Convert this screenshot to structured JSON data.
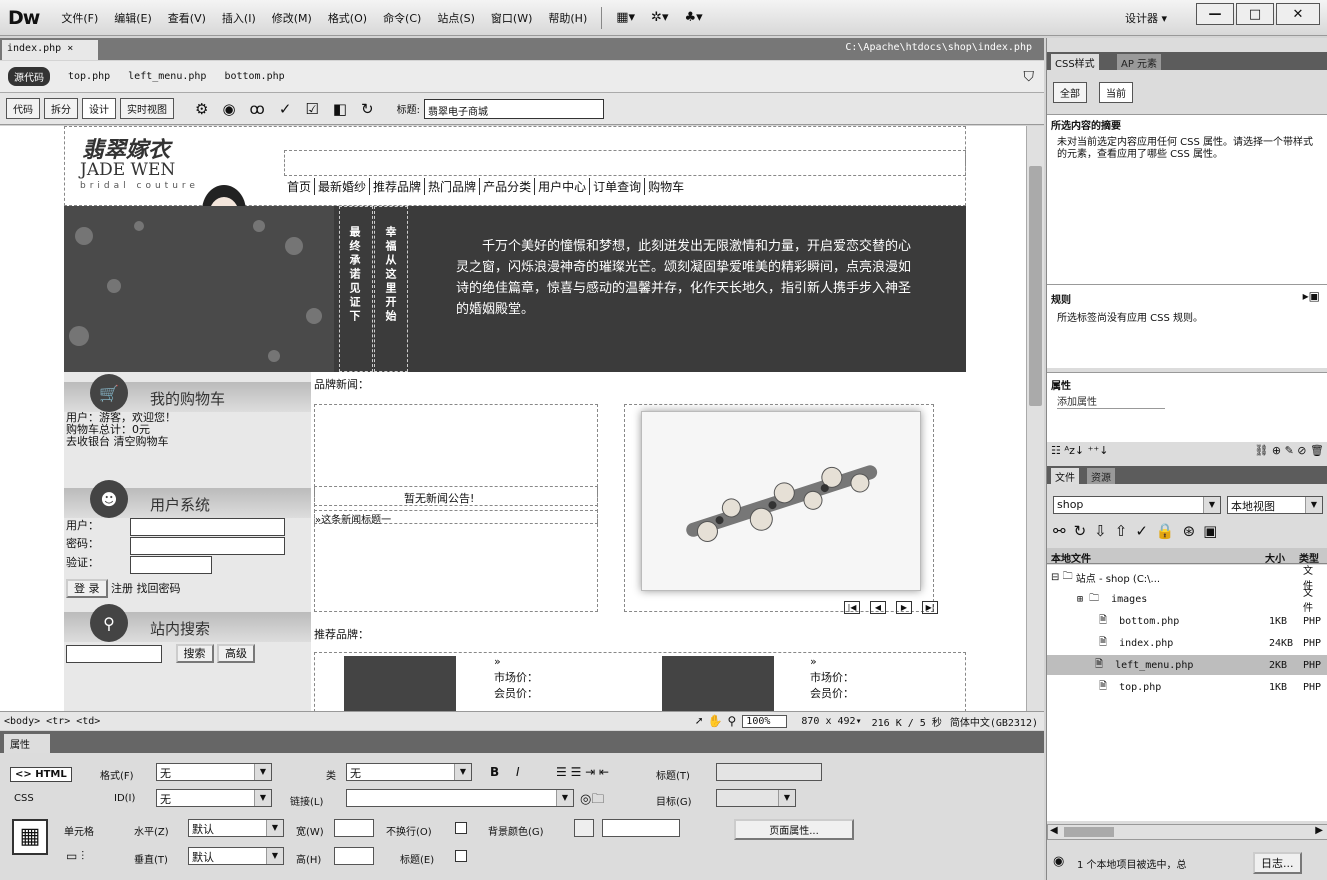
{
  "app": {
    "logo": "Dw",
    "designer": "设计器 ▾"
  },
  "menu": [
    "文件(F)",
    "编辑(E)",
    "查看(V)",
    "插入(I)",
    "修改(M)",
    "格式(O)",
    "命令(C)",
    "站点(S)",
    "窗口(W)",
    "帮助(H)"
  ],
  "doc": {
    "tab": "index.php ×",
    "path": "C:\\Apache\\htdocs\\shop\\index.php",
    "source_code": "源代码",
    "related": [
      "top.php",
      "left_menu.php",
      "bottom.php"
    ]
  },
  "toolbar": {
    "views": [
      "代码",
      "拆分",
      "设计",
      "实时视图"
    ],
    "title_label": "标题:",
    "title_value": "翡翠电子商城"
  },
  "site": {
    "logo_cn": "翡翠嫁衣",
    "logo_en": "JADE WEN",
    "logo_sub": "bridal couture",
    "nav": [
      "首页",
      "最新婚纱",
      "推荐品牌",
      "热门品牌",
      "产品分类",
      "用户中心",
      "订单查询",
      "购物车"
    ],
    "vtext1": "最终承诺见证下",
    "vtext2": "幸福从这里开始",
    "banner_text": "千万个美好的憧憬和梦想，此刻迸发出无限激情和力量，开启爱恋交替的心灵之窗，闪烁浪漫神奇的璀璨光芒。颂刻凝固挚爱唯美的精彩瞬间，点亮浪漫如诗的绝佳篇章，惊喜与感动的温馨并存，化作天长地久，指引新人携手步入神圣的婚姻殿堂。",
    "cart": {
      "title": "我的购物车",
      "line1": "用户：游客，欢迎您！",
      "line2": "购物车总计：0元",
      "line3": "去收银台  清空购物车"
    },
    "user": {
      "title": "用户系统",
      "user_label": "用户：",
      "pwd_label": "密码：",
      "code_label": "验证：",
      "login": "登 录",
      "links": "注册 找回密码"
    },
    "search": {
      "title": "站内搜索",
      "search_btn": "搜索",
      "adv_btn": "高级"
    },
    "news": {
      "title": "品牌新闻：",
      "empty": "暂无新闻公告!",
      "item": "»这条新闻标题一"
    },
    "brands": {
      "title": "推荐品牌：",
      "arrow": "»",
      "market_price": "市场价：",
      "member_price": "会员价："
    }
  },
  "status": {
    "tags": "<body> <tr> <td>",
    "zoom": "100%",
    "size": "870 x 492▾",
    "info": "216 K / 5 秒",
    "encoding": "简体中文(GB2312)"
  },
  "props": {
    "header": "属性",
    "html": "<> HTML",
    "css": "CSS",
    "format_label": "格式(F)",
    "format_value": "无",
    "class_label": "类",
    "class_value": "无",
    "id_label": "ID(I)",
    "id_value": "无",
    "link_label": "链接(L)",
    "target_label": "目标(G)",
    "title_label": "标题(T)",
    "cell_label": "单元格",
    "h_label": "水平(Z)",
    "h_value": "默认",
    "v_label": "垂直(T)",
    "v_value": "默认",
    "w_label": "宽(W)",
    "h2_label": "高(H)",
    "nowrap_label": "不换行(O)",
    "header_label": "标题(E)",
    "bg_label": "背景颜色(G)",
    "page_props": "页面属性..."
  },
  "css_panel": {
    "tabs": [
      "CSS样式",
      "AP 元素"
    ],
    "modes": [
      "全部",
      "当前"
    ],
    "summary_title": "所选内容的摘要",
    "summary_text": "未对当前选定内容应用任何 CSS 属性。请选择一个带样式的元素，查看应用了哪些 CSS 属性。",
    "rules_title": "规则",
    "rules_text": "所选标签尚没有应用 CSS 规则。",
    "props_title": "属性",
    "add_prop": "添加属性"
  },
  "files_panel": {
    "tabs": [
      "文件",
      "资源"
    ],
    "site": "shop",
    "view": "本地视图",
    "col_local": "本地文件",
    "col_size": "大小",
    "col_type": "类型",
    "root": "站点 - shop (C:\\...",
    "root_type": "文件",
    "files": [
      {
        "name": "images",
        "size": "",
        "type": "文件"
      },
      {
        "name": "bottom.php",
        "size": "1KB",
        "type": "PHP"
      },
      {
        "name": "index.php",
        "size": "24KB",
        "type": "PHP"
      },
      {
        "name": "left_menu.php",
        "size": "2KB",
        "type": "PHP"
      },
      {
        "name": "top.php",
        "size": "1KB",
        "type": "PHP"
      }
    ],
    "status": "1 个本地项目被选中，总",
    "log": "日志..."
  }
}
